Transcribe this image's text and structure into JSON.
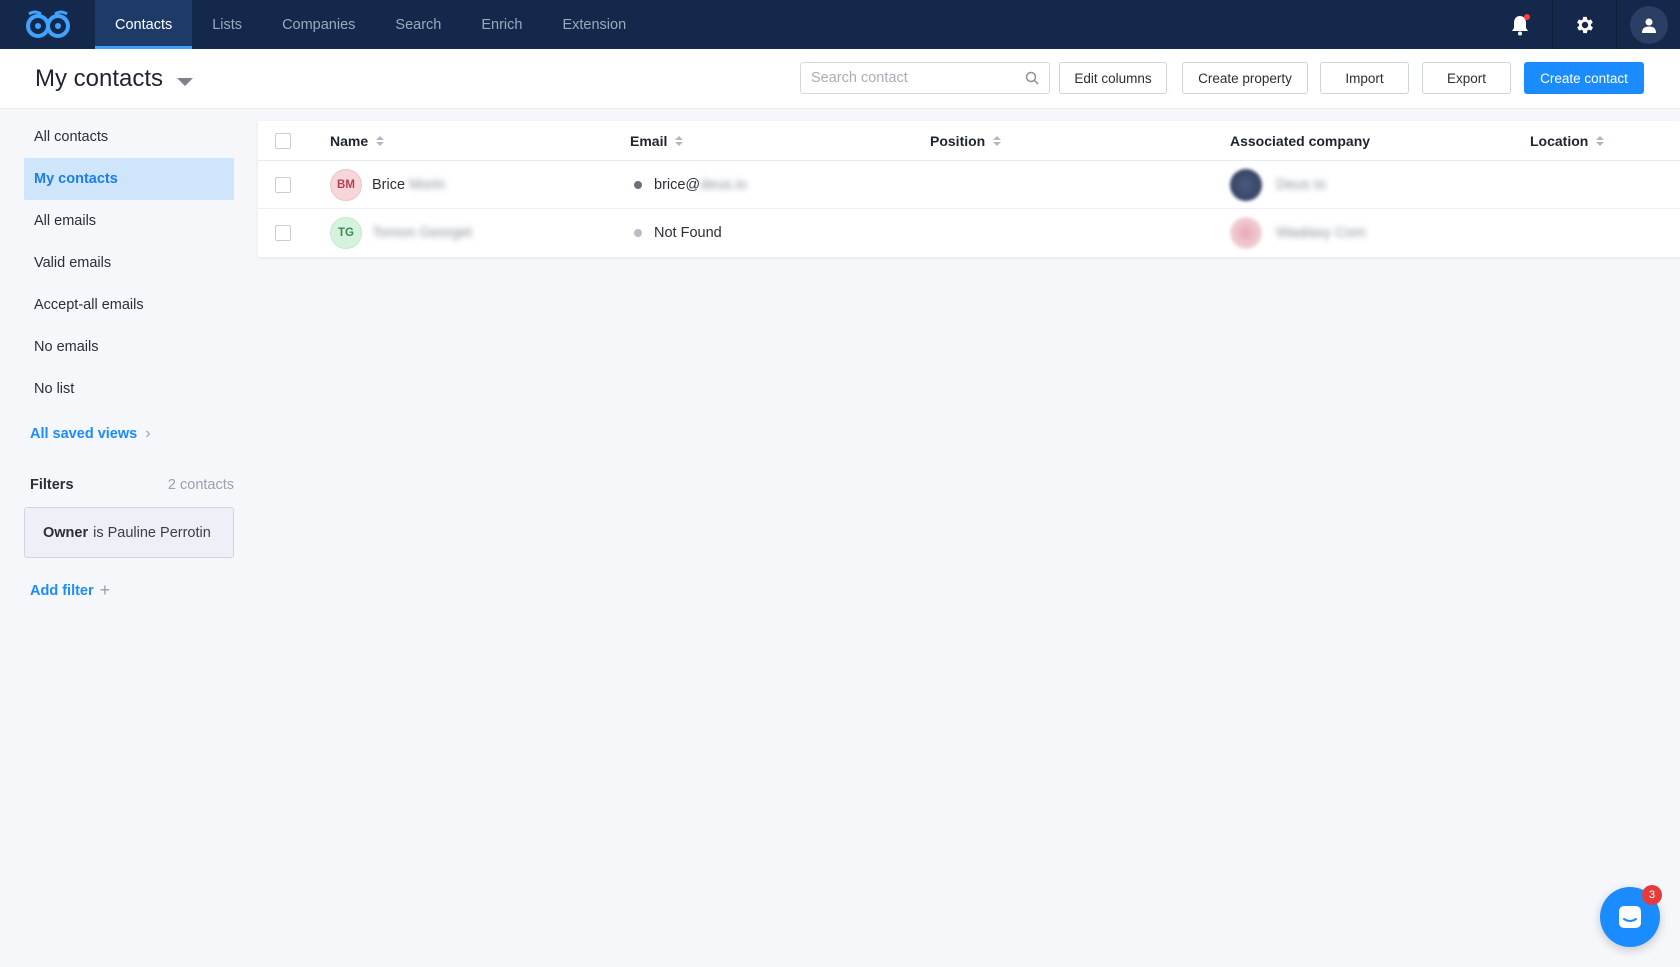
{
  "nav": {
    "tabs": [
      {
        "label": "Contacts",
        "active": true
      },
      {
        "label": "Lists"
      },
      {
        "label": "Companies"
      },
      {
        "label": "Search"
      },
      {
        "label": "Enrich"
      },
      {
        "label": "Extension"
      }
    ],
    "icons": [
      "owl-logo-icon",
      "bell-icon",
      "gear-icon",
      "user-icon"
    ]
  },
  "header": {
    "title": "My contacts",
    "search_placeholder": "Search contact",
    "buttons": {
      "edit_columns": "Edit columns",
      "create_property": "Create property",
      "import": "Import",
      "export": "Export",
      "create_contact": "Create contact"
    }
  },
  "sidebar": {
    "items": [
      {
        "label": "All contacts"
      },
      {
        "label": "My contacts",
        "active": true
      },
      {
        "label": "All emails"
      },
      {
        "label": "Valid emails"
      },
      {
        "label": "Accept-all emails"
      },
      {
        "label": "No emails"
      },
      {
        "label": "No list"
      }
    ],
    "saved_views": "All saved views",
    "filters_label": "Filters",
    "filters_count": "2 contacts",
    "filter": {
      "field": "Owner",
      "rest": "is Pauline Perrotin"
    },
    "add_filter": "Add filter"
  },
  "table": {
    "columns": [
      "Name",
      "Email",
      "Position",
      "Associated company",
      "Location"
    ],
    "rows": [
      {
        "initials": "BM",
        "first": "Brice",
        "last_blurred": "Morin",
        "email_prefix": "brice@",
        "email_blurred": "deus.io",
        "email_status_color": "#6b7178",
        "company_blurred": "Deus Io"
      },
      {
        "initials": "TG",
        "first": "",
        "last_blurred": "Tomon Georget",
        "email_prefix": "Not Found",
        "email_blurred": "",
        "email_status_color": "#b9bec6",
        "company_blurred": "Waalaxy Com"
      }
    ]
  },
  "chat": {
    "badge": "3"
  },
  "colors": {
    "nav_bg": "#14284b",
    "accent": "#1a8cff",
    "active_side_bg": "#cfe5fb",
    "badge": "#e43c3c"
  }
}
